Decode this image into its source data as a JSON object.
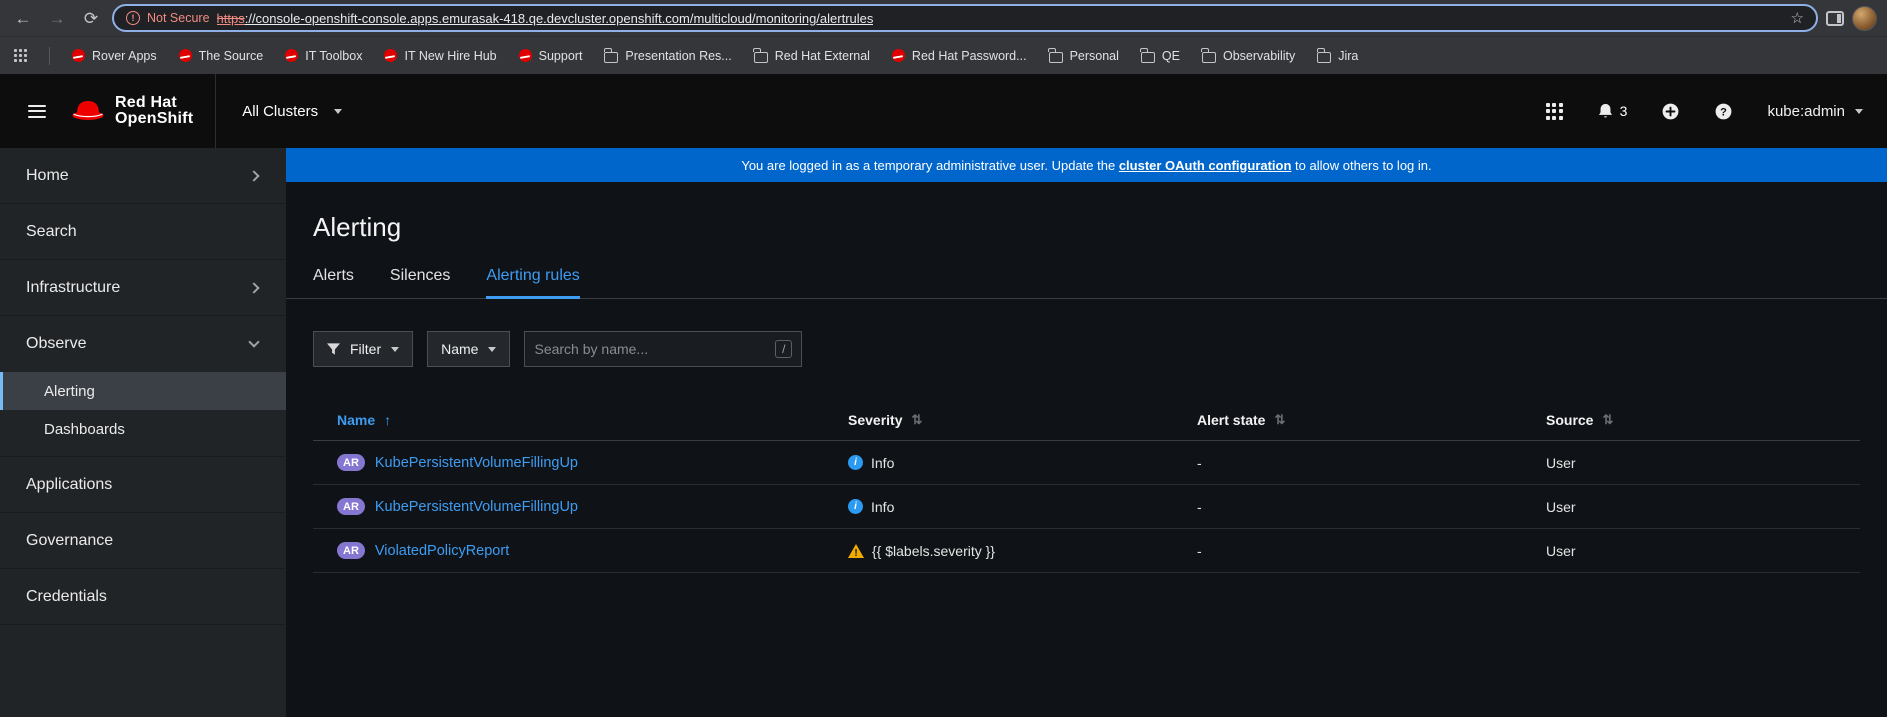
{
  "browser": {
    "not_secure": "Not Secure",
    "not_secure_glyph": "!",
    "url_scheme": "https",
    "url_rest": "://console-openshift-console.apps.emurasak-418.qe.devcluster.openshift.com/multicloud/monitoring/alertrules",
    "back_glyph": "←",
    "forward_glyph": "→",
    "reload_glyph": "⟳",
    "star_glyph": "☆",
    "bookmarks": [
      {
        "label": "Rover Apps",
        "icon": "redhat"
      },
      {
        "label": "The Source",
        "icon": "redhat"
      },
      {
        "label": "IT Toolbox",
        "icon": "redhat"
      },
      {
        "label": "IT New Hire Hub",
        "icon": "redhat"
      },
      {
        "label": "Support",
        "icon": "redhat"
      },
      {
        "label": "Presentation Res...",
        "icon": "folder"
      },
      {
        "label": "Red Hat External",
        "icon": "folder"
      },
      {
        "label": "Red Hat Password...",
        "icon": "redhat"
      },
      {
        "label": "Personal",
        "icon": "folder"
      },
      {
        "label": "QE",
        "icon": "folder"
      },
      {
        "label": "Observability",
        "icon": "folder"
      },
      {
        "label": "Jira",
        "icon": "folder"
      }
    ]
  },
  "masthead": {
    "brand_line1": "Red Hat",
    "brand_line2": "OpenShift",
    "cluster_selector": "All Clusters",
    "notification_count": "3",
    "help_glyph": "?",
    "username": "kube:admin"
  },
  "banner": {
    "text_before": "You are logged in as a temporary administrative user. Update the ",
    "link_text": "cluster OAuth configuration",
    "text_after": " to allow others to log in."
  },
  "sidebar": {
    "items": [
      {
        "label": "Home"
      },
      {
        "label": "Search"
      },
      {
        "label": "Infrastructure"
      },
      {
        "label": "Observe"
      },
      {
        "label": "Applications"
      },
      {
        "label": "Governance"
      },
      {
        "label": "Credentials"
      }
    ],
    "observe_children": [
      {
        "label": "Alerting"
      },
      {
        "label": "Dashboards"
      }
    ]
  },
  "page": {
    "title": "Alerting",
    "tabs": [
      {
        "label": "Alerts"
      },
      {
        "label": "Silences"
      },
      {
        "label": "Alerting rules"
      }
    ],
    "toolbar": {
      "filter_label": "Filter",
      "name_label": "Name",
      "search_placeholder": "Search by name...",
      "search_shortcut": "/"
    },
    "table": {
      "columns": [
        "Name",
        "Severity",
        "Alert state",
        "Source"
      ],
      "sort_arrow_glyph": "↑",
      "sort_icon_glyph": "⇅",
      "rows": [
        {
          "badge": "AR",
          "name": "KubePersistentVolumeFillingUp",
          "severity": "Info",
          "severity_icon": "info",
          "alert_state": "-",
          "source": "User"
        },
        {
          "badge": "AR",
          "name": "KubePersistentVolumeFillingUp",
          "severity": "Info",
          "severity_icon": "info",
          "alert_state": "-",
          "source": "User"
        },
        {
          "badge": "AR",
          "name": "ViolatedPolicyReport",
          "severity": "{{ $labels.severity }}",
          "severity_icon": "warning",
          "alert_state": "-",
          "source": "User"
        }
      ]
    }
  },
  "colors": {
    "banner_blue": "#0066cc",
    "link_blue": "#3e9cf2",
    "info_blue": "#2b9af3",
    "warning_yellow": "#f0ab00",
    "badge_purple": "#8476d1",
    "brand_red": "#ee0000"
  }
}
